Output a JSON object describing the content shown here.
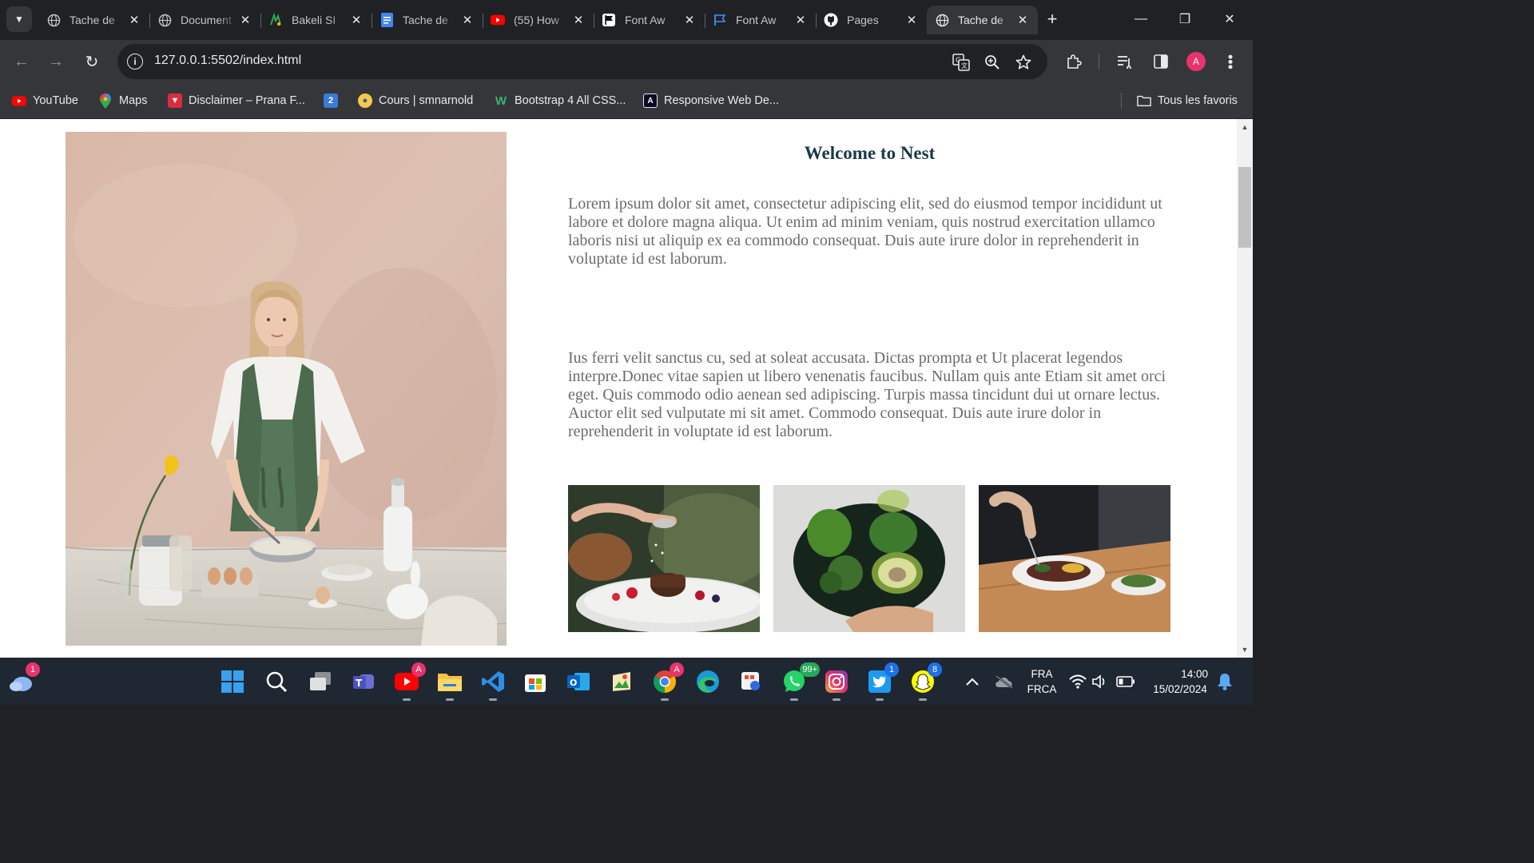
{
  "browser": {
    "tabs": [
      {
        "title": "Tache de",
        "icon": "globe-icon"
      },
      {
        "title": "Document",
        "icon": "globe-icon"
      },
      {
        "title": "Bakeli SI",
        "icon": "bakeli-icon"
      },
      {
        "title": "Tache de",
        "icon": "google-docs-icon"
      },
      {
        "title": "(55) How",
        "icon": "youtube-icon"
      },
      {
        "title": "Font Aw",
        "icon": "flag-icon"
      },
      {
        "title": "Font Aw",
        "icon": "flag-outline-icon"
      },
      {
        "title": "Pages",
        "icon": "github-icon"
      },
      {
        "title": "Tache de",
        "icon": "globe-icon",
        "active": true
      }
    ],
    "url": "127.0.0.1:5502/index.html",
    "profile_initial": "A",
    "bookmarks": [
      {
        "label": "YouTube",
        "icon": "youtube-icon"
      },
      {
        "label": "Maps",
        "icon": "maps-pin-icon"
      },
      {
        "label": "Disclaimer – Prana F...",
        "icon": "prana-icon"
      },
      {
        "label": "",
        "icon": "number-2-icon",
        "glyph": "2"
      },
      {
        "label": "Cours | smnarnold",
        "icon": "cours-icon"
      },
      {
        "label": "Bootstrap 4 All CSS...",
        "icon": "w-icon"
      },
      {
        "label": "Responsive Web De...",
        "icon": "a-icon"
      }
    ],
    "all_bookmarks_label": "Tous les favoris"
  },
  "page": {
    "title": "Welcome to Nest",
    "paragraph_1": "Lorem ipsum dolor sit amet, consectetur adipiscing elit, sed do eiusmod tempor incididunt ut labore et dolore magna aliqua. Ut enim ad minim veniam, quis nostrud exercitation ullamco laboris nisi ut aliquip ex ea commodo consequat. Duis aute irure dolor in reprehenderit in voluptate id est laborum.",
    "paragraph_2": "Ius ferri velit sanctus cu, sed at soleat accusata. Dictas prompta et Ut placerat legendos interpre.Donec vitae sapien ut libero venenatis faucibus. Nullam quis ante Etiam sit amet orci eget. Quis commodo odio aenean sed adipiscing. Turpis massa tincidunt dui ut ornare lectus. Auctor elit sed vulputate mi sit amet. Commodo consequat. Duis aute irure dolor in reprehenderit in voluptate id est laborum."
  },
  "taskbar": {
    "weather_badge": "1",
    "youtube_badge": "A",
    "chrome_badge": "A",
    "whatsapp_badge": "99+",
    "twitter_badge": "1",
    "snapchat_badge": "8",
    "language_line1": "FRA",
    "language_line2": "FRCA",
    "time": "14:00",
    "date": "15/02/2024"
  },
  "colors": {
    "title": "#1a3a47",
    "paragraph": "#6b6b6b",
    "chrome_dark": "#202124",
    "chrome_toolbar": "#35363a",
    "taskbar": "#1f2733"
  }
}
